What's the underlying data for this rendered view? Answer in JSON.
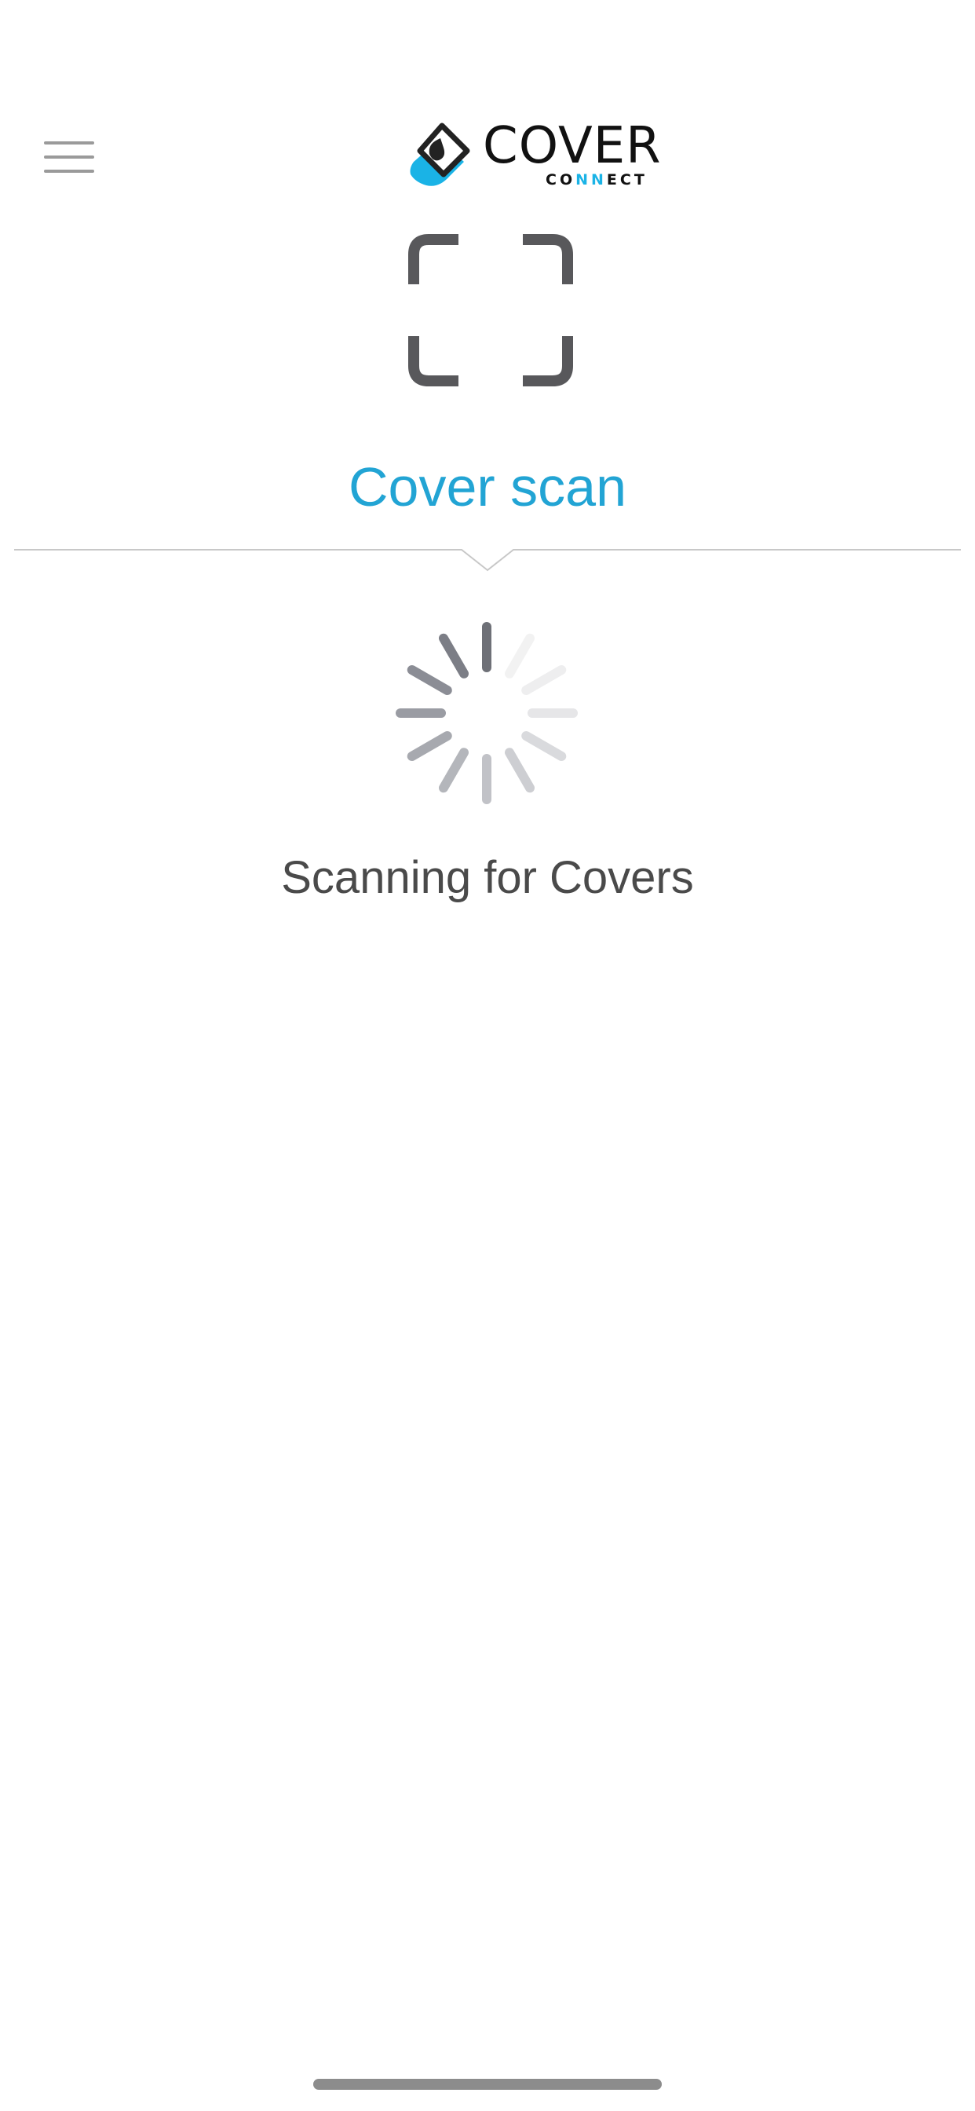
{
  "app": {
    "logo": {
      "wordmark": "COVER",
      "sub_wordmark_parts": [
        "CO",
        "NN",
        "ECT"
      ],
      "brand_colors": {
        "dark": "#111111",
        "accent": "#1ab3e6"
      }
    }
  },
  "header": {
    "menu_icon": "hamburger-menu-icon"
  },
  "scan": {
    "icon": "scan-frame-icon",
    "title": "Cover scan",
    "status": "Scanning for Covers",
    "spinner_icon": "loading-spinner-icon"
  },
  "colors": {
    "title": "#22a4d4",
    "status_text": "#4a4a4a",
    "icon_dark": "#58585b",
    "divider": "#c8c8c8"
  }
}
